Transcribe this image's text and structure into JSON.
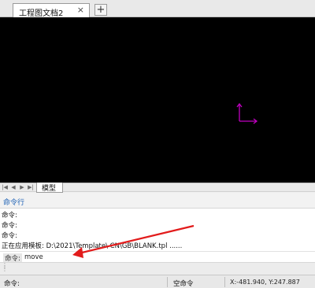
{
  "tabs": {
    "document_title": "工程图文档2",
    "close_glyph": "×",
    "add_glyph": "+"
  },
  "layout_tabs": {
    "nav": [
      "|◀",
      "◀",
      "▶",
      "▶|"
    ],
    "model_label": "模型"
  },
  "command_panel": {
    "title": "命令行",
    "history": [
      "命令:",
      "命令:",
      "命令:",
      "正在应用模板:  D:\\2021\\Template\\   CN\\GB\\BLANK.tpl ......"
    ],
    "prompt": "命令:",
    "input_value": "move"
  },
  "status_bar": {
    "command_label": "命令:",
    "state_text": "空命令",
    "coordinates": "X:-481.940, Y:247.887"
  },
  "colors": {
    "ucs_icon": "#c000c0",
    "annotation_arrow": "#e21b1b",
    "canvas_background": "#000000"
  }
}
